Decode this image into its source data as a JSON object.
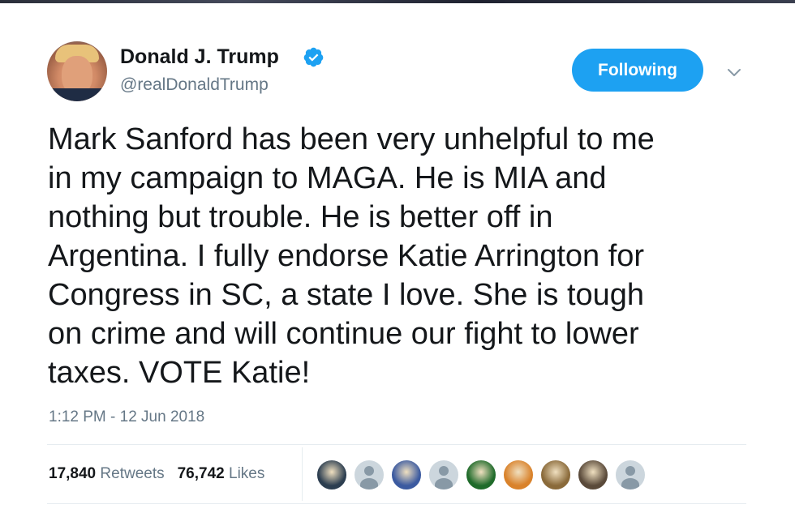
{
  "author": {
    "name": "Donald J. Trump",
    "handle": "@realDonaldTrump",
    "verified": true
  },
  "follow_button": {
    "label": "Following"
  },
  "tweet": {
    "text": "Mark Sanford has been very unhelpful to me\nin my campaign to MAGA. He is MIA and\nnothing but trouble. He is better off in\nArgentina. I fully endorse Katie Arrington for\nCongress in SC, a state I love. She is tough\non crime and will continue our fight to lower\ntaxes. VOTE Katie!",
    "timestamp": "1:12 PM - 12 Jun 2018"
  },
  "stats": {
    "retweets_count": "17,840",
    "retweets_label": "Retweets",
    "likes_count": "76,742",
    "likes_label": "Likes"
  },
  "likers": [
    {
      "kind": "photo",
      "color": "#2c3e50"
    },
    {
      "kind": "default",
      "color": "#ccd6dd"
    },
    {
      "kind": "photo",
      "color": "#3b5aa0"
    },
    {
      "kind": "default",
      "color": "#ccd6dd"
    },
    {
      "kind": "photo",
      "color": "#1f6b2a"
    },
    {
      "kind": "photo",
      "color": "#d9822b"
    },
    {
      "kind": "photo",
      "color": "#8a6a3a"
    },
    {
      "kind": "photo",
      "color": "#5a4a3a"
    },
    {
      "kind": "default",
      "color": "#ccd6dd"
    }
  ],
  "colors": {
    "accent": "#1da1f2",
    "text": "#14171a",
    "secondary": "#657786"
  },
  "icons": {
    "verified": "verified-badge-icon",
    "caret": "chevron-down-icon"
  }
}
